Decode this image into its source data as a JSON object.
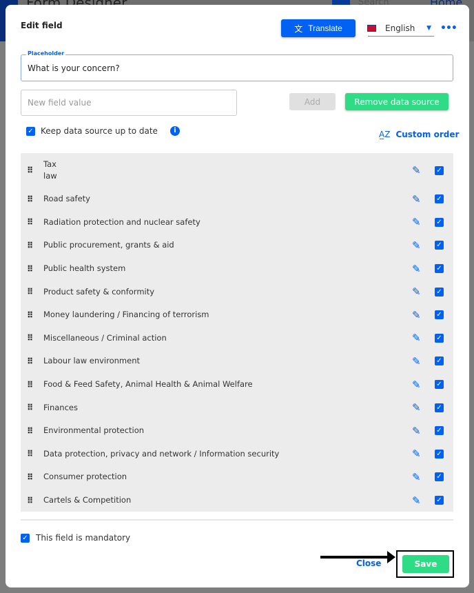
{
  "background": {
    "title": "Form Designer",
    "search": "Search",
    "home": "Home"
  },
  "dialog": {
    "title": "Edit field",
    "translate_label": "Translate",
    "language": "English",
    "placeholder_label": "Placeholder",
    "placeholder_value": "What is your concern?",
    "new_field_placeholder": "New field value",
    "add_label": "Add",
    "remove_label": "Remove data source",
    "keep_label": "Keep data source up to date",
    "keep_checked": true,
    "custom_order_label": "Custom order",
    "items": [
      {
        "label": "Tax\nlaw",
        "checked": true
      },
      {
        "label": "Road safety",
        "checked": true
      },
      {
        "label": "Radiation protection and nuclear safety",
        "checked": true
      },
      {
        "label": "Public procurement, grants & aid",
        "checked": true
      },
      {
        "label": "Public health system",
        "checked": true
      },
      {
        "label": "Product safety & conformity",
        "checked": true
      },
      {
        "label": "Money laundering / Financing of terrorism",
        "checked": true
      },
      {
        "label": "Miscellaneous / Criminal action",
        "checked": true
      },
      {
        "label": "Labour law environment",
        "checked": true
      },
      {
        "label": "Food & Feed Safety, Animal Health & Animal Welfare",
        "checked": true
      },
      {
        "label": "Finances",
        "checked": true
      },
      {
        "label": "Environmental protection",
        "checked": true
      },
      {
        "label": "Data protection, privacy and network / Information security",
        "checked": true
      },
      {
        "label": "Consumer protection",
        "checked": true
      },
      {
        "label": "Cartels & Competition",
        "checked": true
      }
    ],
    "mandatory_label": "This field is mandatory",
    "mandatory_checked": true,
    "close_label": "Close",
    "save_label": "Save"
  },
  "colors": {
    "primary": "#0061f2",
    "success": "#2ddc84"
  }
}
